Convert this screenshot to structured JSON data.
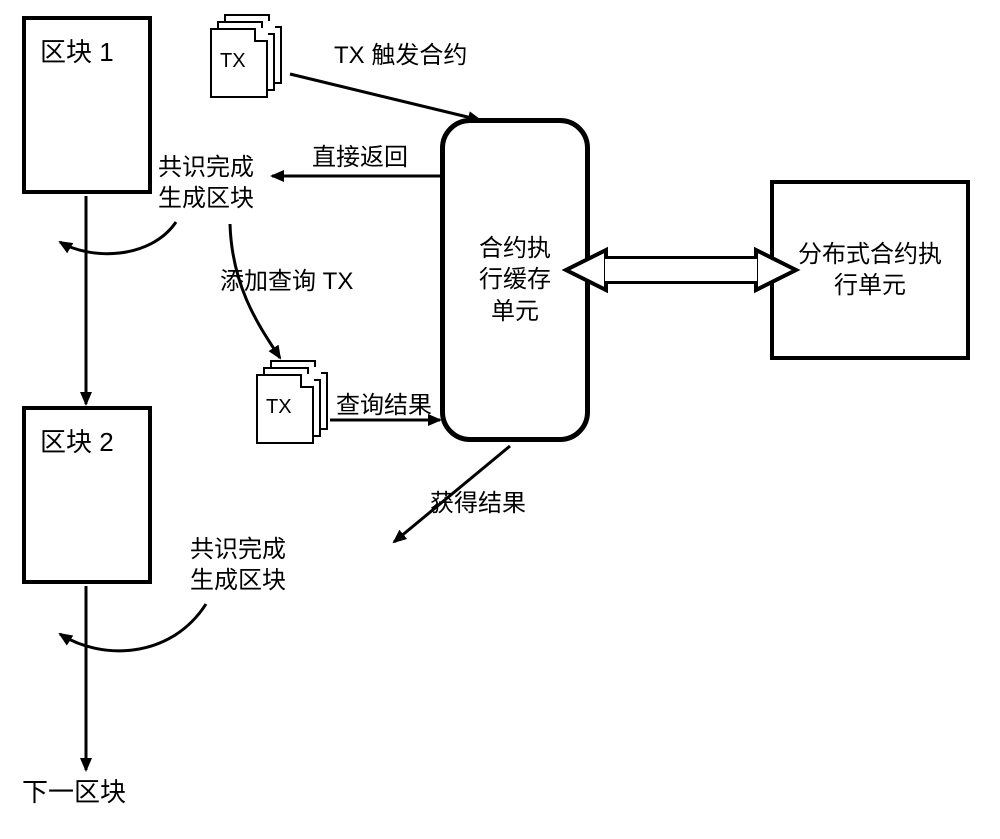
{
  "blocks": {
    "block1": "区块 1",
    "block2": "区块 2",
    "nextBlock": "下一区块"
  },
  "tx": {
    "label1": "TX",
    "label2": "TX"
  },
  "nodes": {
    "cache": "合约执\n行缓存\n单元",
    "dist": "分布式合约执\n行单元"
  },
  "arrows": {
    "trigger": "TX 触发合约",
    "directReturn": "直接返回",
    "consensus1": "共识完成\n生成区块",
    "addQueryTx": "添加查询 TX",
    "queryResult": "查询结果",
    "getResult": "获得结果",
    "consensus2": "共识完成\n生成区块"
  }
}
